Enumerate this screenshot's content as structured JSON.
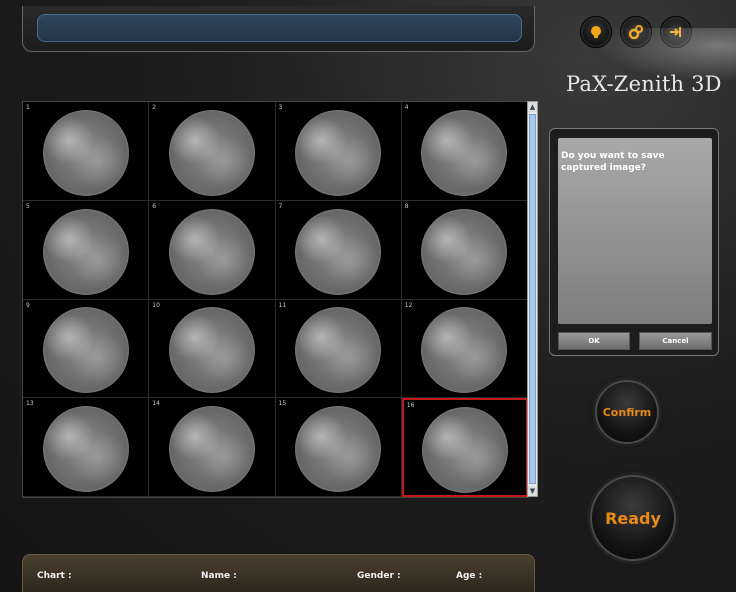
{
  "brand": "PaX-Zenith 3D",
  "header_icons": [
    "light-bulb-icon",
    "settings-gear-icon",
    "exit-icon"
  ],
  "thumbnails": [
    {
      "number": "1"
    },
    {
      "number": "2"
    },
    {
      "number": "3"
    },
    {
      "number": "4"
    },
    {
      "number": "5"
    },
    {
      "number": "6"
    },
    {
      "number": "7"
    },
    {
      "number": "8"
    },
    {
      "number": "9"
    },
    {
      "number": "10"
    },
    {
      "number": "11"
    },
    {
      "number": "12"
    },
    {
      "number": "13"
    },
    {
      "number": "14"
    },
    {
      "number": "15"
    },
    {
      "number": "16"
    }
  ],
  "selected_thumbnail": "16",
  "dialog": {
    "message": "Do you want to save captured image?",
    "ok_label": "OK",
    "cancel_label": "Cancel"
  },
  "confirm_label": "Confirm",
  "ready_label": "Ready",
  "patient_info": {
    "chart_label": "Chart :",
    "name_label": "Name :",
    "gender_label": "Gender :",
    "age_label": "Age :"
  },
  "colors": {
    "accent": "#e88a16",
    "selection_border": "#c21a1a",
    "status_field": "#2d4258"
  }
}
